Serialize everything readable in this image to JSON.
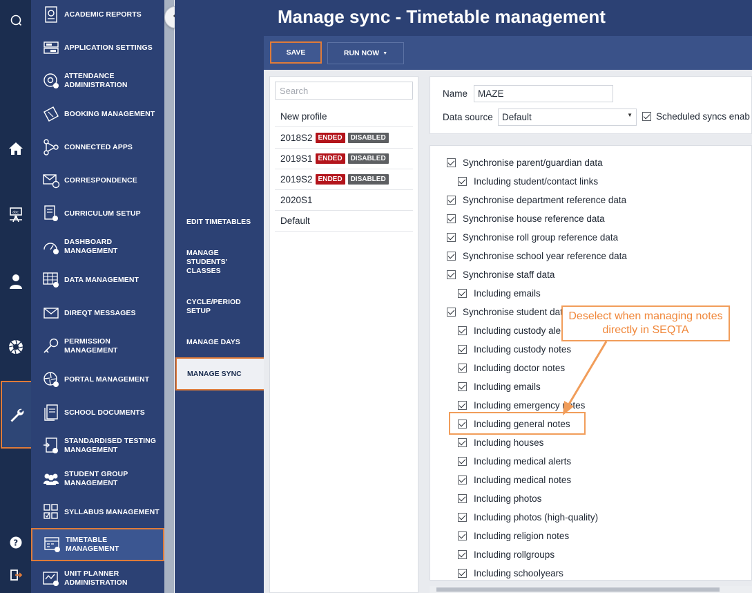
{
  "header": {
    "title": "Manage sync - Timetable management"
  },
  "toolbar": {
    "save_label": "SAVE",
    "run_now_label": "RUN NOW"
  },
  "admin_menu": {
    "items": [
      {
        "label": "ACADEMIC REPORTS",
        "icon": "report-icon"
      },
      {
        "label": "APPLICATION SETTINGS",
        "icon": "settings-panel-icon"
      },
      {
        "label": "ATTENDANCE ADMINISTRATION",
        "icon": "at-gear-icon"
      },
      {
        "label": "BOOKING MANAGEMENT",
        "icon": "ticket-icon"
      },
      {
        "label": "CONNECTED APPS",
        "icon": "network-icon"
      },
      {
        "label": "CORRESPONDENCE",
        "icon": "mail-chat-icon"
      },
      {
        "label": "CURRICULUM SETUP",
        "icon": "document-gear-icon"
      },
      {
        "label": "DASHBOARD MANAGEMENT",
        "icon": "gauge-gear-icon"
      },
      {
        "label": "DATA MANAGEMENT",
        "icon": "table-gear-icon"
      },
      {
        "label": "DIREQT MESSAGES",
        "icon": "inbox-icon"
      },
      {
        "label": "PERMISSION MANAGEMENT",
        "icon": "key-icon"
      },
      {
        "label": "PORTAL MANAGEMENT",
        "icon": "portal-gear-icon"
      },
      {
        "label": "SCHOOL DOCUMENTS",
        "icon": "documents-icon"
      },
      {
        "label": "STANDARDISED TESTING MANAGEMENT",
        "icon": "test-icon"
      },
      {
        "label": "STUDENT GROUP MANAGEMENT",
        "icon": "group-icon"
      },
      {
        "label": "SYLLABUS MANAGEMENT",
        "icon": "checklist-icon"
      },
      {
        "label": "TIMETABLE MANAGEMENT",
        "icon": "timetable-gear-icon"
      },
      {
        "label": "UNIT PLANNER ADMINISTRATION",
        "icon": "unit-planner-icon"
      }
    ],
    "active": "TIMETABLE MANAGEMENT"
  },
  "sub_menu": {
    "items": [
      {
        "label": "EDIT TIMETABLES"
      },
      {
        "label": "MANAGE STUDENTS' CLASSES"
      },
      {
        "label": "CYCLE/PERIOD SETUP"
      },
      {
        "label": "MANAGE DAYS"
      },
      {
        "label": "MANAGE SYNC"
      }
    ],
    "active": "MANAGE SYNC"
  },
  "profiles": {
    "search_placeholder": "Search",
    "items": [
      {
        "name": "New profile",
        "badges": []
      },
      {
        "name": "2018S2",
        "badges": [
          "ENDED",
          "DISABLED"
        ]
      },
      {
        "name": "2019S1",
        "badges": [
          "ENDED",
          "DISABLED"
        ]
      },
      {
        "name": "2019S2",
        "badges": [
          "ENDED",
          "DISABLED"
        ]
      },
      {
        "name": "2020S1",
        "badges": []
      },
      {
        "name": "Default",
        "badges": []
      }
    ]
  },
  "form": {
    "name_label": "Name",
    "name_value": "MAZE",
    "data_source_label": "Data source",
    "data_source_value": "Default",
    "scheduled_label": "Scheduled syncs enab",
    "scheduled_checked": true
  },
  "sync_options": [
    {
      "label": "Synchronise parent/guardian data",
      "level": 0,
      "checked": true
    },
    {
      "label": "Including student/contact links",
      "level": 1,
      "checked": true
    },
    {
      "label": "Synchronise department reference data",
      "level": 0,
      "checked": true
    },
    {
      "label": "Synchronise house reference data",
      "level": 0,
      "checked": true
    },
    {
      "label": "Synchronise roll group reference data",
      "level": 0,
      "checked": true
    },
    {
      "label": "Synchronise school year reference data",
      "level": 0,
      "checked": true
    },
    {
      "label": "Synchronise staff data",
      "level": 0,
      "checked": true
    },
    {
      "label": "Including emails",
      "level": 1,
      "checked": true
    },
    {
      "label": "Synchronise student data",
      "level": 0,
      "checked": true
    },
    {
      "label": "Including custody alerts",
      "level": 1,
      "checked": true
    },
    {
      "label": "Including custody notes",
      "level": 1,
      "checked": true
    },
    {
      "label": "Including doctor notes",
      "level": 1,
      "checked": true
    },
    {
      "label": "Including emails",
      "level": 1,
      "checked": true
    },
    {
      "label": "Including emergency notes",
      "level": 1,
      "checked": true
    },
    {
      "label": "Including general notes",
      "level": 1,
      "checked": true
    },
    {
      "label": "Including houses",
      "level": 1,
      "checked": true
    },
    {
      "label": "Including medical alerts",
      "level": 1,
      "checked": true
    },
    {
      "label": "Including medical notes",
      "level": 1,
      "checked": true
    },
    {
      "label": "Including photos",
      "level": 1,
      "checked": true
    },
    {
      "label": "Including photos (high-quality)",
      "level": 1,
      "checked": true
    },
    {
      "label": "Including religion notes",
      "level": 1,
      "checked": true
    },
    {
      "label": "Including rollgroups",
      "level": 1,
      "checked": true
    },
    {
      "label": "Including schoolyears",
      "level": 1,
      "checked": true
    }
  ],
  "annotation": {
    "text": "Deselect when managing notes directly in SEQTA",
    "highlight_color": "#f19d5a"
  },
  "colors": {
    "rail": "#1b2d4f",
    "menu": "#2c4174",
    "accent_outline": "#e07b39",
    "ended_badge": "#b3141b",
    "disabled_badge": "#5d5f62"
  }
}
